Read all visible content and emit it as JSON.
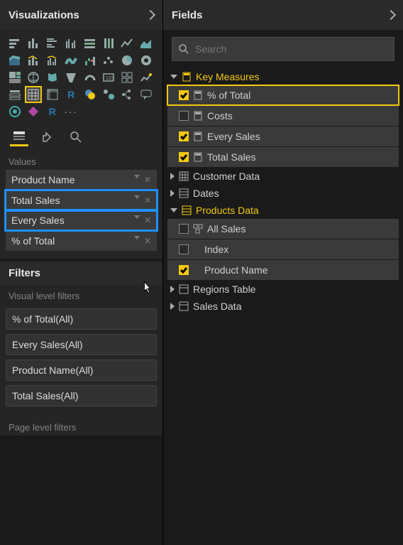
{
  "viz": {
    "title": "Visualizations",
    "values_label": "Values",
    "wells": [
      {
        "label": "Product Name",
        "highlight": false
      },
      {
        "label": "Total Sales",
        "highlight": true
      },
      {
        "label": "Every Sales",
        "highlight": true
      },
      {
        "label": "% of Total",
        "highlight": false
      }
    ]
  },
  "filters": {
    "title": "Filters",
    "visual_label": "Visual level filters",
    "page_label": "Page level filters",
    "items": [
      "% of Total(All)",
      "Every Sales(All)",
      "Product Name(All)",
      "Total Sales(All)"
    ]
  },
  "fields": {
    "title": "Fields",
    "search_placeholder": "Search",
    "tables": [
      {
        "name": "Key Measures",
        "expanded": true,
        "active": true,
        "icon": "calc",
        "fields": [
          {
            "name": "% of Total",
            "checked": true,
            "selected": true,
            "icon": "calc"
          },
          {
            "name": "Costs",
            "checked": false,
            "selected": false,
            "icon": "calc"
          },
          {
            "name": "Every Sales",
            "checked": true,
            "selected": false,
            "icon": "calc"
          },
          {
            "name": "Total Sales",
            "checked": true,
            "selected": false,
            "icon": "calc"
          }
        ]
      },
      {
        "name": "Customer Data",
        "expanded": false,
        "active": false,
        "icon": "table",
        "fields": []
      },
      {
        "name": "Dates",
        "expanded": false,
        "active": false,
        "icon": "table",
        "fields": []
      },
      {
        "name": "Products Data",
        "expanded": true,
        "active": true,
        "icon": "table",
        "fields": [
          {
            "name": "All Sales",
            "checked": false,
            "selected": false,
            "icon": "hier"
          },
          {
            "name": "Index",
            "checked": false,
            "selected": false,
            "icon": "none"
          },
          {
            "name": "Product Name",
            "checked": true,
            "selected": false,
            "icon": "none"
          }
        ]
      },
      {
        "name": "Regions Table",
        "expanded": false,
        "active": false,
        "icon": "table",
        "fields": []
      },
      {
        "name": "Sales Data",
        "expanded": false,
        "active": false,
        "icon": "table",
        "fields": []
      }
    ]
  }
}
